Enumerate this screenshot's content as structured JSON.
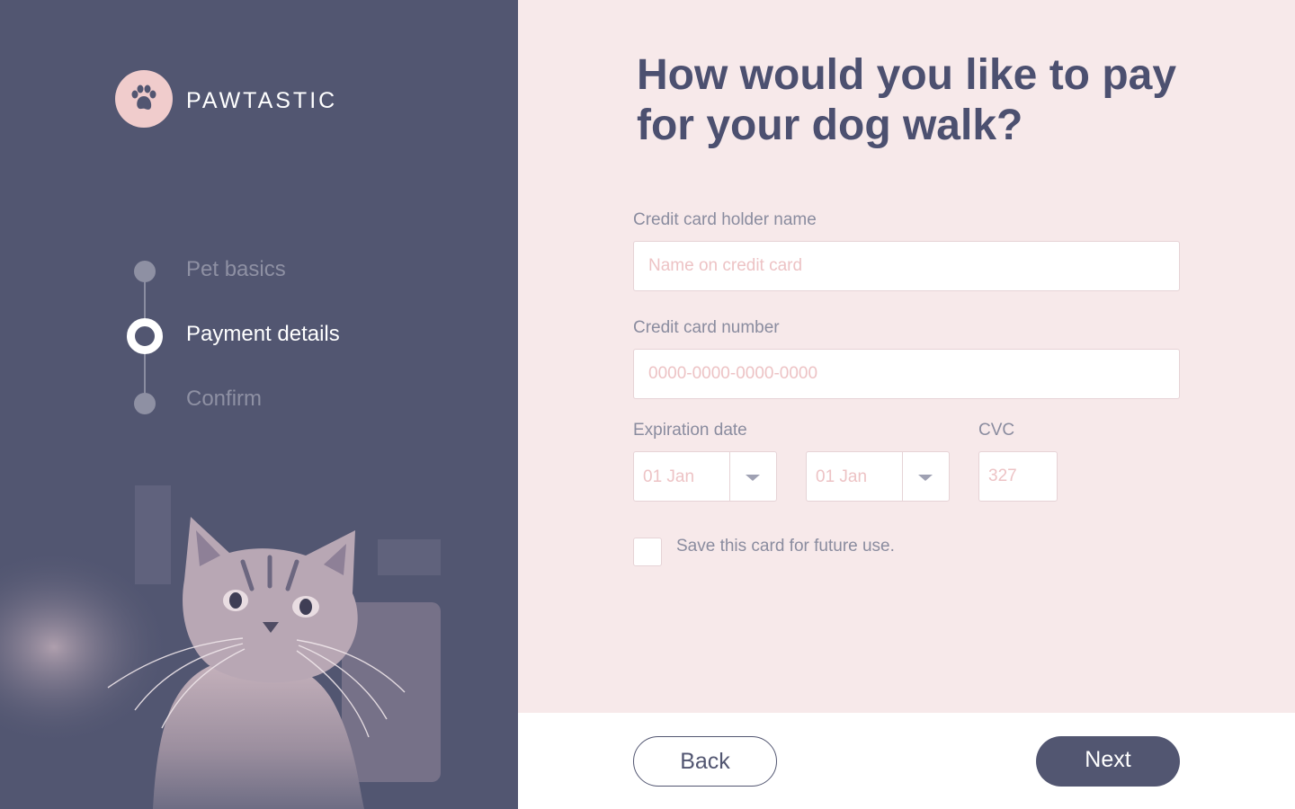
{
  "brand": {
    "name": "PAWTASTIC",
    "logo_icon": "paw-icon"
  },
  "steps": [
    {
      "label": "Pet basics",
      "state": "done"
    },
    {
      "label": "Payment details",
      "state": "active"
    },
    {
      "label": "Confirm",
      "state": "upcoming"
    }
  ],
  "heading": "How would you like to pay for your dog walk?",
  "form": {
    "holder": {
      "label": "Credit card holder name",
      "placeholder": "Name on credit card"
    },
    "number": {
      "label": "Credit card number",
      "placeholder": "0000-0000-0000-0000"
    },
    "expiration": {
      "label": "Expiration date",
      "month": "01 Jan",
      "year": "01 Jan"
    },
    "cvc": {
      "label": "CVC",
      "placeholder": "327"
    },
    "save_card": {
      "label": "Save this card for future use.",
      "checked": false
    }
  },
  "footer": {
    "back_label": "Back",
    "next_label": "Next"
  },
  "colors": {
    "sidebar": "#525671",
    "background": "#f7e9ea",
    "accent": "#4c5070",
    "placeholder": "#edc3c5",
    "logo": "#f0cccc"
  }
}
